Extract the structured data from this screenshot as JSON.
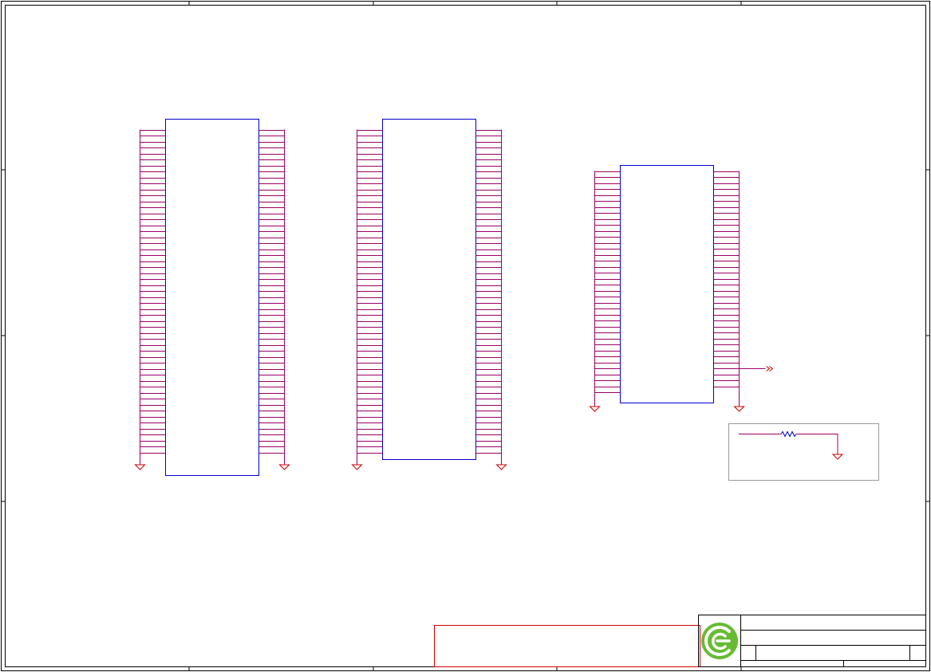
{
  "sheet": {
    "colors": {
      "frame": "#000000",
      "component_body": "#0000cc",
      "pin": "#990066",
      "wire": "#990066",
      "ground": "#cc0000",
      "note_box": "#cc0000",
      "group_box": "#999999",
      "logo": "#66bb33"
    }
  },
  "components": [
    {
      "id": "U1",
      "left_pins": 55,
      "right_pins": 55,
      "left_ground": true,
      "right_ground": true
    },
    {
      "id": "U2",
      "left_pins": 55,
      "right_pins": 55,
      "left_ground": true,
      "right_ground": true
    },
    {
      "id": "U3",
      "left_pins": 38,
      "right_pins": 37,
      "left_ground": true,
      "right_ground": true,
      "right_signal_out": true
    }
  ],
  "resistor_group": {
    "components": [
      "resistor",
      "ground"
    ]
  },
  "title_block": {
    "logo_icon": "circular-e-logo"
  }
}
